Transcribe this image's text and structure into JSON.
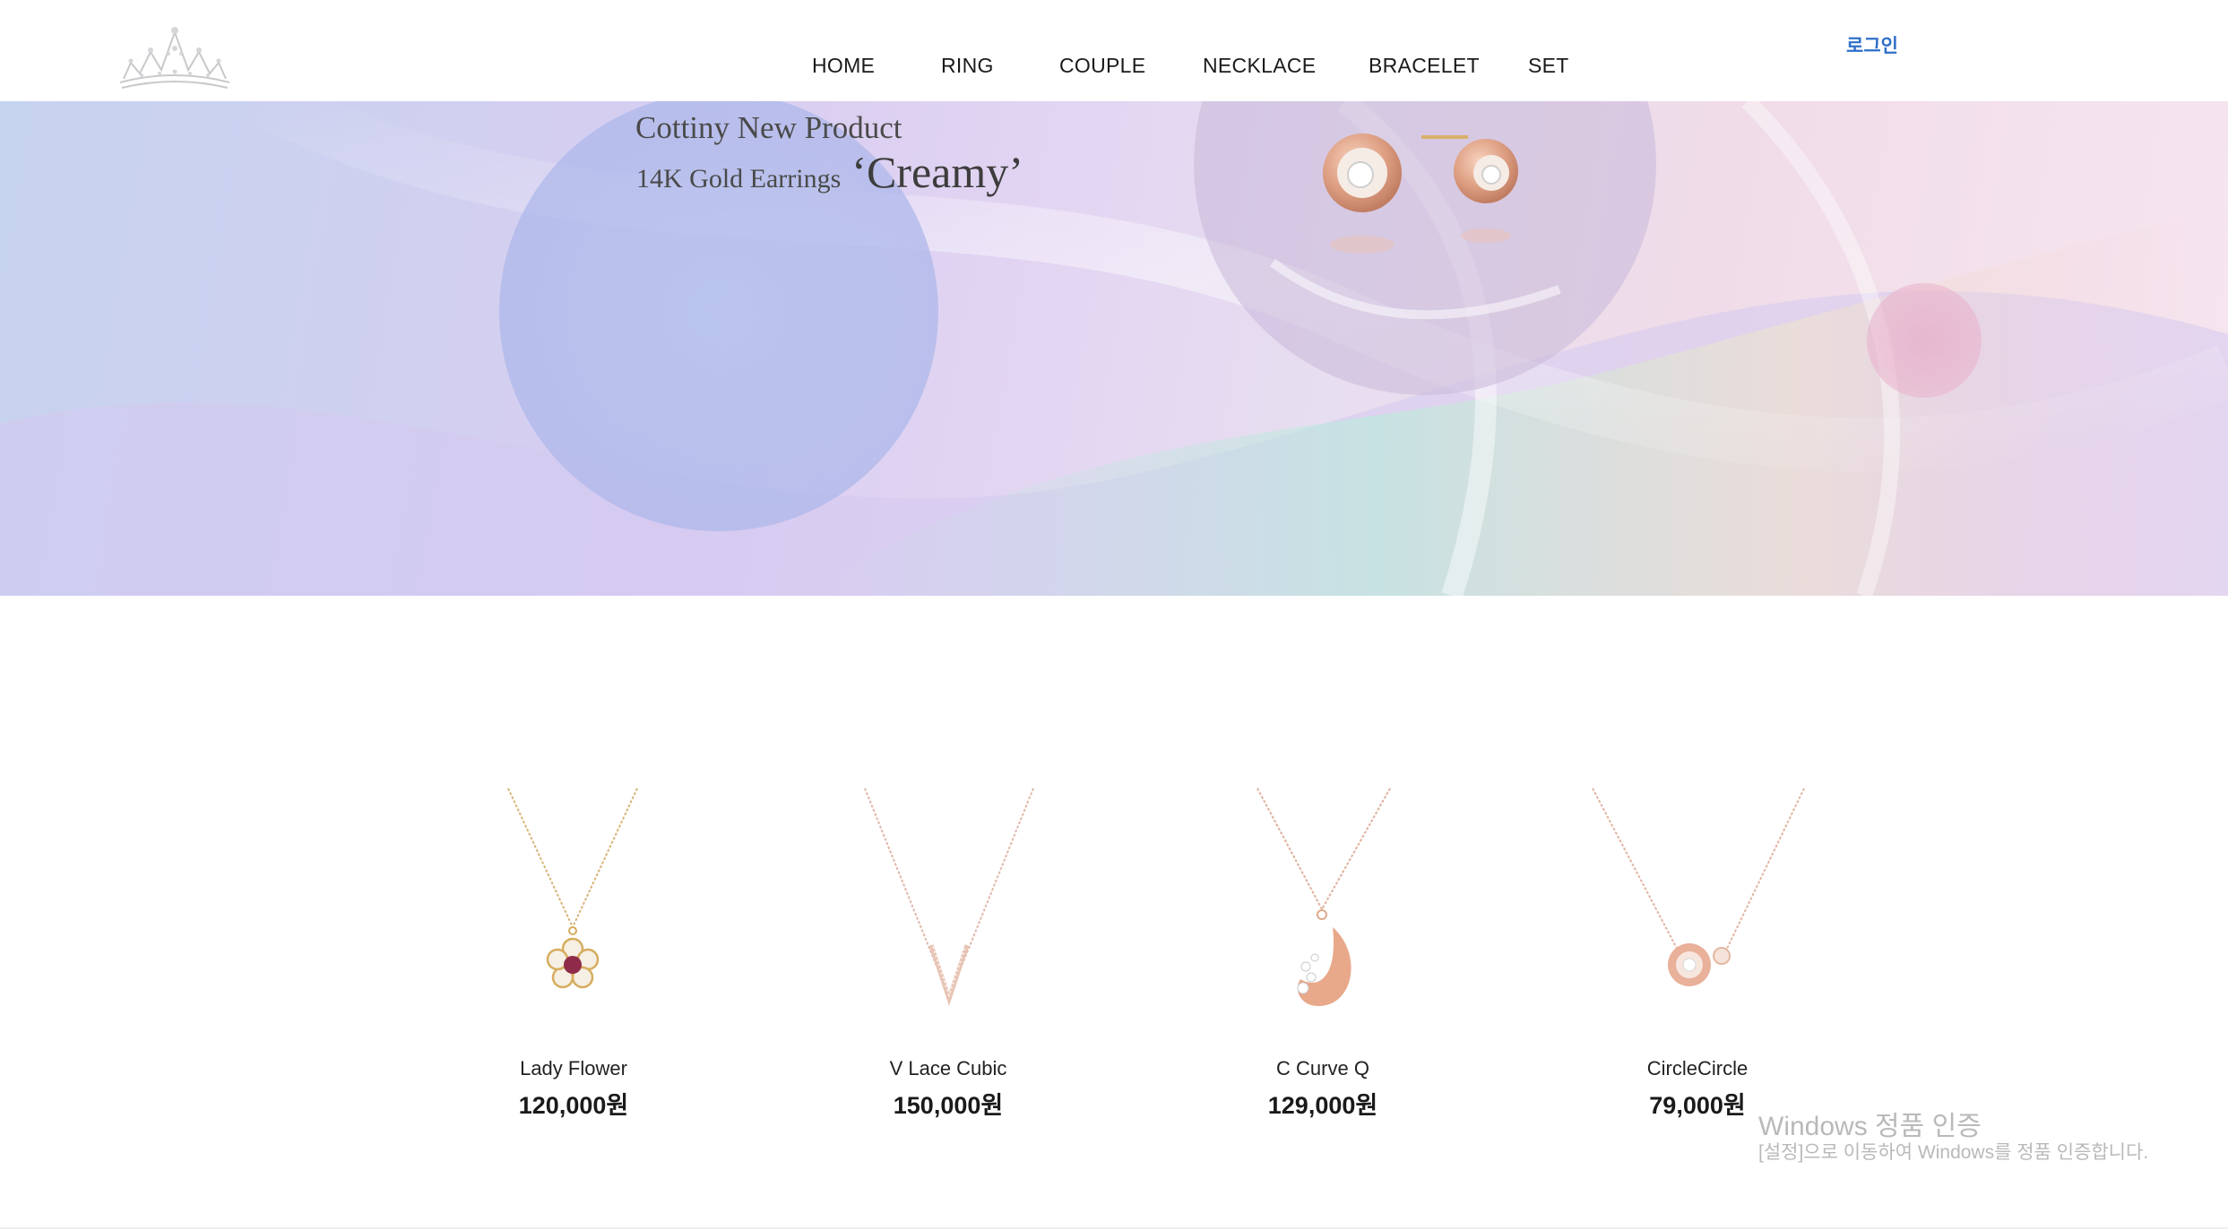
{
  "header": {
    "logo_icon": "tiara-icon",
    "nav": [
      {
        "label": "HOME"
      },
      {
        "label": "RING"
      },
      {
        "label": "COUPLE"
      },
      {
        "label": "NECKLACE"
      },
      {
        "label": "BRACELET"
      },
      {
        "label": "SET"
      }
    ],
    "login_label": "로그인",
    "login_color": "#2f6fc9"
  },
  "hero": {
    "line1": "Cottiny New Product",
    "line2": "14K Gold Earrings",
    "highlight": "‘Creamy’",
    "image_icon": "earrings-icon"
  },
  "products": [
    {
      "name": "Lady Flower",
      "price": "120,000원",
      "icon": "flower-necklace-icon"
    },
    {
      "name": "V Lace Cubic",
      "price": "150,000원",
      "icon": "v-necklace-icon"
    },
    {
      "name": "C Curve Q",
      "price": "129,000원",
      "icon": "curve-pendant-necklace-icon"
    },
    {
      "name": "CircleCircle",
      "price": "79,000원",
      "icon": "circle-pendant-necklace-icon"
    }
  ],
  "watermark": {
    "title": "Windows 정품 인증",
    "subtitle": "[설정]으로 이동하여 Windows를 정품 인증합니다."
  }
}
